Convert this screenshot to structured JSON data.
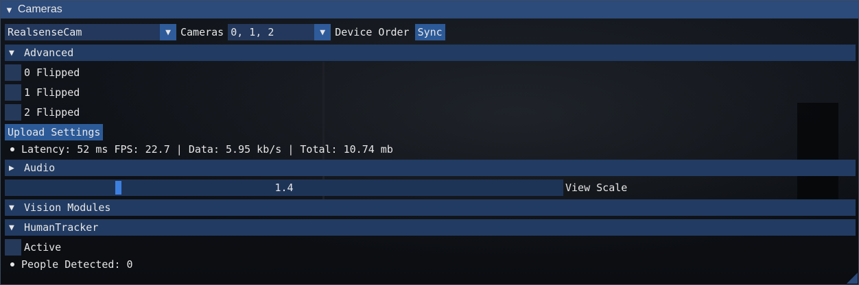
{
  "window": {
    "title": "Cameras",
    "collapse_glyph": "▼"
  },
  "camera_select": {
    "value": "RealsenseCam",
    "arrow": "▼"
  },
  "cameras_label": "Cameras",
  "order_select": {
    "value": "0, 1, 2",
    "arrow": "▼"
  },
  "device_order_label": "Device Order",
  "sync_button": "Sync",
  "advanced": {
    "title": "Advanced",
    "glyph": "▼"
  },
  "flips": [
    {
      "label": "0 Flipped",
      "checked": false
    },
    {
      "label": "1 Flipped",
      "checked": false
    },
    {
      "label": "2 Flipped",
      "checked": false
    }
  ],
  "upload_button": "Upload Settings",
  "stats": "Latency: 52 ms FPS: 22.7 | Data: 5.95 kb/s | Total: 10.74 mb",
  "audio": {
    "title": "Audio",
    "glyph": "▶"
  },
  "view_scale": {
    "value": "1.4",
    "label": "View Scale",
    "fraction": 0.2
  },
  "vision_modules": {
    "title": "Vision Modules",
    "glyph": "▼"
  },
  "human_tracker": {
    "title": "HumanTracker",
    "glyph": "▼"
  },
  "active": {
    "label": "Active",
    "checked": false
  },
  "people_detected": "People Detected: 0",
  "colors": {
    "titlebar": "#2c4a7a",
    "header": "#223b62",
    "accent": "#3d7fe0"
  }
}
